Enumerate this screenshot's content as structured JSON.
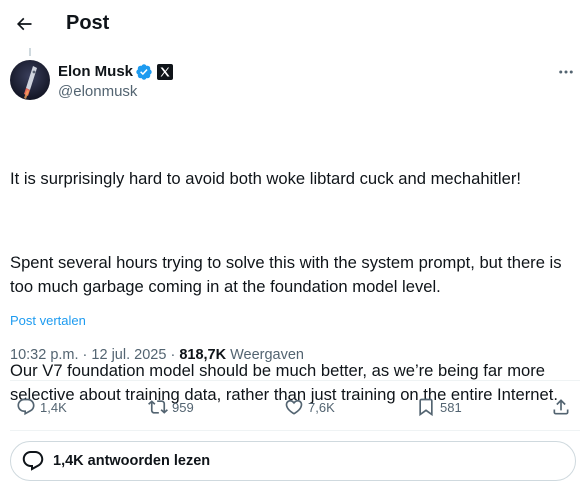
{
  "header": {
    "title": "Post"
  },
  "author": {
    "display_name": "Elon Musk",
    "handle": "@elonmusk"
  },
  "tweet": {
    "paragraphs": [
      "It is surprisingly hard to avoid both woke libtard cuck and mechahitler!",
      "Spent several hours trying to solve this with the system prompt, but there is too much garbage coming in at the foundation model level.",
      "Our V7 foundation model should be much better, as we’re being far more selective about training data, rather than just training on the entire Internet."
    ],
    "translate_label": "Post vertalen"
  },
  "meta": {
    "time": "10:32 p.m.",
    "separator": "·",
    "date": "12 jul. 2025",
    "views_count": "818,7K",
    "views_label": "Weergaven"
  },
  "actions": {
    "replies": "1,4K",
    "reposts": "959",
    "likes": "7,6K",
    "bookmarks": "581"
  },
  "replies_button": {
    "label": "1,4K antwoorden lezen"
  },
  "colors": {
    "text": "#0f1419",
    "secondary": "#536471",
    "accent": "#1d9bf0",
    "border": "#cfd9de",
    "divider": "#eff3f4"
  },
  "icons": [
    "back-arrow-icon",
    "verified-badge-icon",
    "x-logo-icon",
    "more-dots-icon",
    "reply-icon",
    "repost-icon",
    "like-icon",
    "bookmark-icon",
    "share-icon",
    "chat-bubble-icon"
  ]
}
